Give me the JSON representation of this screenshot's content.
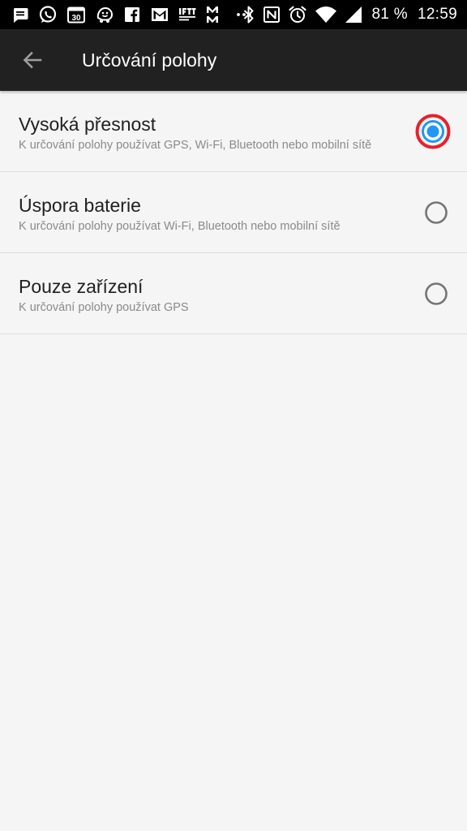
{
  "status_bar": {
    "battery_percent": "81 %",
    "time": "12:59",
    "calendar_day": "30",
    "app_icons": [
      "message-icon",
      "whatsapp-icon",
      "calendar-icon",
      "waze-icon",
      "facebook-icon",
      "gmail-icon",
      "ifttt-icon",
      "mm-icon",
      "more-notifications-icon"
    ],
    "system_icons": [
      "bluetooth-icon",
      "nfc-icon",
      "alarm-icon",
      "wifi-icon",
      "cell-signal-icon"
    ]
  },
  "app_bar": {
    "title": "Určování polohy",
    "back_icon": "arrow-back-icon"
  },
  "options": [
    {
      "title": "Vysoká přesnost",
      "subtitle": "K určování polohy používat GPS, Wi-Fi, Bluetooth nebo mobilní sítě",
      "selected": true
    },
    {
      "title": "Úspora baterie",
      "subtitle": "K určování polohy používat Wi-Fi, Bluetooth nebo mobilní sítě",
      "selected": false
    },
    {
      "title": "Pouze zařízení",
      "subtitle": "K určování polohy používat GPS",
      "selected": false
    }
  ],
  "colors": {
    "status_bar_bg": "#000000",
    "app_bar_bg": "#212121",
    "page_bg": "#f5f5f5",
    "radio_selected": "#2196f3",
    "radio_highlight_ring": "#e8202a",
    "radio_unselected": "#757575",
    "divider": "#dddddd"
  }
}
